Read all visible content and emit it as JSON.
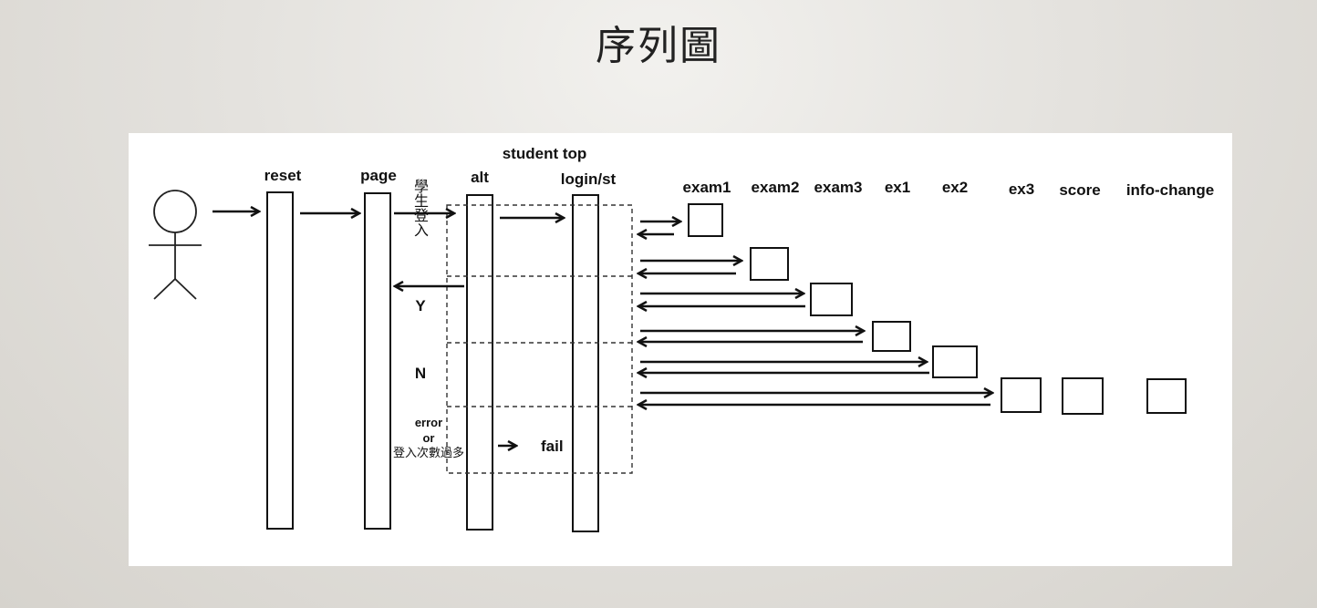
{
  "slide": {
    "title": "序列圖"
  },
  "diagram": {
    "header": "student top",
    "participants": [
      "reset",
      "page",
      "alt",
      "login/st",
      "exam1",
      "exam2",
      "exam3",
      "ex1",
      "ex2",
      "ex3",
      "score",
      "info-change"
    ],
    "login_message": "學生登入",
    "branch_yes": "Y",
    "branch_no": "N",
    "error_note": {
      "line1": "error",
      "line2": "or",
      "line3": "登入次數過多"
    },
    "fail_label": "fail"
  }
}
